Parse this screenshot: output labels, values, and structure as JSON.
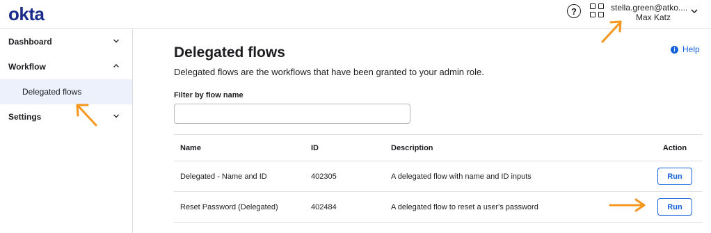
{
  "header": {
    "logo": "okta",
    "help_icon": "question-circle-icon",
    "apps_icon": "apps-grid-icon",
    "user_email": "stella.green@atko....",
    "user_name": "Max Katz"
  },
  "sidebar": {
    "items": [
      {
        "label": "Dashboard",
        "expanded": false
      },
      {
        "label": "Workflow",
        "expanded": true,
        "children": [
          {
            "label": "Delegated flows",
            "selected": true
          }
        ]
      },
      {
        "label": "Settings",
        "expanded": false
      }
    ]
  },
  "main": {
    "title": "Delegated flows",
    "description": "Delegated flows are the workflows that have been granted to your admin role.",
    "help_label": "Help",
    "filter": {
      "label": "Filter by flow name",
      "value": "",
      "placeholder": ""
    },
    "table": {
      "columns": [
        "Name",
        "ID",
        "Description",
        "Action"
      ],
      "rows": [
        {
          "name": "Delegated - Name and ID",
          "id": "402305",
          "description": "A delegated flow with name and ID inputs",
          "action": "Run"
        },
        {
          "name": "Reset Password (Delegated)",
          "id": "402484",
          "description": "A delegated flow to reset a user's password",
          "action": "Run"
        }
      ]
    }
  },
  "colors": {
    "accent": "#1662dd",
    "brand": "#1a2b8a",
    "selected_bg": "#ecf1fb",
    "annotation_arrow": "#f5961d"
  }
}
